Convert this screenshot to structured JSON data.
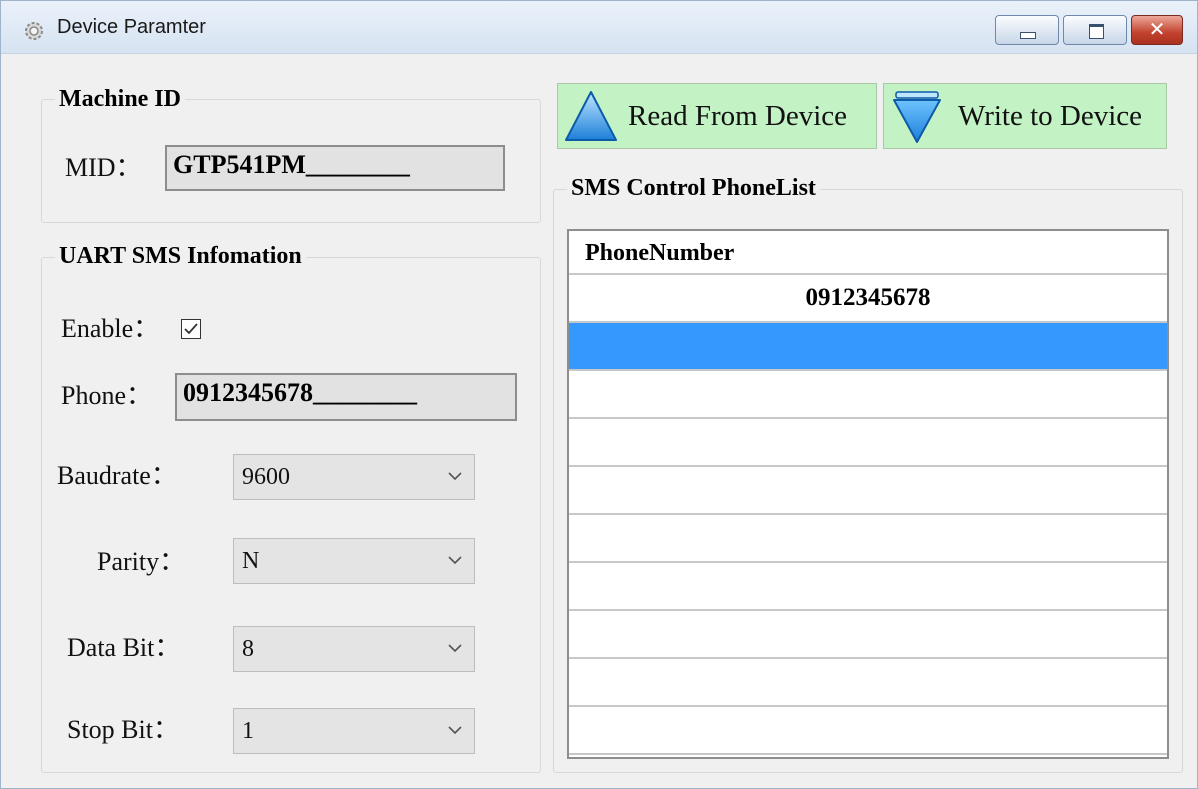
{
  "window": {
    "title": "Device Paramter",
    "close_glyph": "✕"
  },
  "machine_id": {
    "legend": "Machine ID",
    "mid_label": "MID：",
    "mid_value": "GTP541PM________"
  },
  "uart": {
    "legend": "UART SMS Infomation",
    "enable_label": "Enable：",
    "enable_checked": true,
    "phone_label": "Phone：",
    "phone_value": "0912345678________",
    "baudrate_label": "Baudrate：",
    "baudrate_value": "9600",
    "parity_label": "Parity：",
    "parity_value": "N",
    "databit_label": "Data Bit：",
    "databit_value": "8",
    "stopbit_label": "Stop Bit：",
    "stopbit_value": "1"
  },
  "actions": {
    "read_label": "Read From Device",
    "write_label": "Write to Device"
  },
  "phonelist": {
    "legend": "SMS Control PhoneList",
    "column_header": "PhoneNumber",
    "rows": [
      "0912345678",
      "",
      "",
      "",
      "",
      "",
      "",
      "",
      "",
      ""
    ],
    "selected_row": 1
  },
  "colors": {
    "button_bg": "#c3f2c5",
    "selection": "#3399ff",
    "close_button": "#c2432e"
  }
}
